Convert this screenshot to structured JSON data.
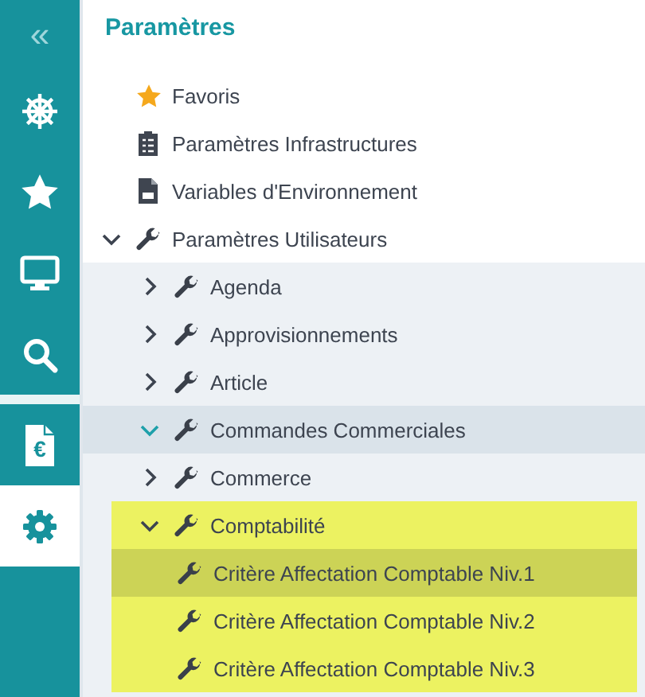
{
  "sidebar": {
    "collapse": "«",
    "items": [
      {
        "kind": "helm",
        "selected": false,
        "group_start": false
      },
      {
        "kind": "star",
        "selected": false,
        "group_start": false
      },
      {
        "kind": "monitor",
        "selected": false,
        "group_start": false
      },
      {
        "kind": "search",
        "selected": false,
        "group_start": false
      },
      {
        "kind": "invoice",
        "glyph": "€",
        "selected": false,
        "group_start": true
      },
      {
        "kind": "settings",
        "selected": true,
        "group_start": false
      }
    ]
  },
  "title": "Paramètres",
  "tree": [
    {
      "label": "Favoris",
      "kind": "star",
      "selected": false
    },
    {
      "label": "Paramètres Infrastructures",
      "kind": "clipboard",
      "selected": false
    },
    {
      "label": "Variables d'Environnement",
      "kind": "document",
      "selected": false
    },
    {
      "label": "Paramètres Utilisateurs",
      "kind": "wrench",
      "expanded": true,
      "selected": false,
      "children": [
        {
          "label": "Agenda",
          "kind": "wrench",
          "expanded": false,
          "selected": false
        },
        {
          "label": "Approvisionnements",
          "kind": "wrench",
          "expanded": false,
          "selected": false
        },
        {
          "label": "Article",
          "kind": "wrench",
          "expanded": false,
          "selected": false
        },
        {
          "label": "Commandes Commerciales",
          "kind": "wrench",
          "expanded": true,
          "hovered": true,
          "selected": false
        },
        {
          "label": "Commerce",
          "kind": "wrench",
          "expanded": false,
          "selected": false
        },
        {
          "label": "Comptabilité",
          "kind": "wrench",
          "expanded": true,
          "marked": true,
          "selected": false,
          "children": [
            {
              "label": "Critère Affectation Comptable Niv.1",
              "kind": "wrench",
              "selected": true
            },
            {
              "label": "Critère Affectation Comptable Niv.2",
              "kind": "wrench",
              "selected": false
            },
            {
              "label": "Critère Affectation Comptable Niv.3",
              "kind": "wrench",
              "selected": false
            }
          ]
        }
      ]
    }
  ]
}
